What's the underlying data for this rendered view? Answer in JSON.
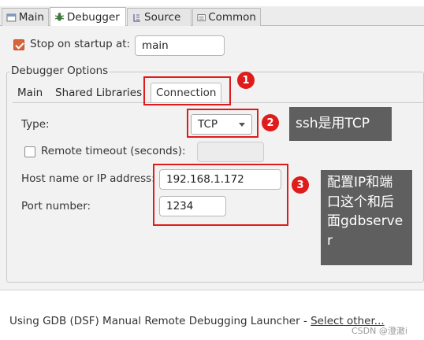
{
  "tabs": [
    {
      "label": "Main",
      "icon": "main-tab-icon"
    },
    {
      "label": "Debugger",
      "icon": "debugger-bug-icon"
    },
    {
      "label": "Source",
      "icon": "source-icon"
    },
    {
      "label": "Common",
      "icon": "common-icon"
    }
  ],
  "stop_on_startup": {
    "label": "Stop on startup at:",
    "checked": true,
    "value": "main"
  },
  "debugger_options": {
    "title": "Debugger Options"
  },
  "subtabs": [
    {
      "label": "Main"
    },
    {
      "label": "Shared Libraries"
    },
    {
      "label": "Connection"
    }
  ],
  "connection": {
    "type_label": "Type:",
    "type_value": "TCP",
    "remote_timeout_label": "Remote timeout (seconds):",
    "remote_timeout_checked": false,
    "remote_timeout_value": "",
    "host_label": "Host name or IP address:",
    "host_value": "192.168.1.172",
    "port_label": "Port number:",
    "port_value": "1234"
  },
  "annotations": {
    "badge1": "1",
    "badge2": "2",
    "badge3": "3",
    "callout2": "ssh是用TCP",
    "callout3": "配置IP和端口这个和后面gdbserver"
  },
  "footer": {
    "launcher_text": "Using GDB (DSF) Manual Remote Debugging Launcher - ",
    "select_other": "Select other..."
  },
  "watermark": "CSDN @澄澈i",
  "colors": {
    "annotation_red": "#e01b1b",
    "callout_bg": "#5f5f5f",
    "checkbox_checked": "#d9643a"
  }
}
